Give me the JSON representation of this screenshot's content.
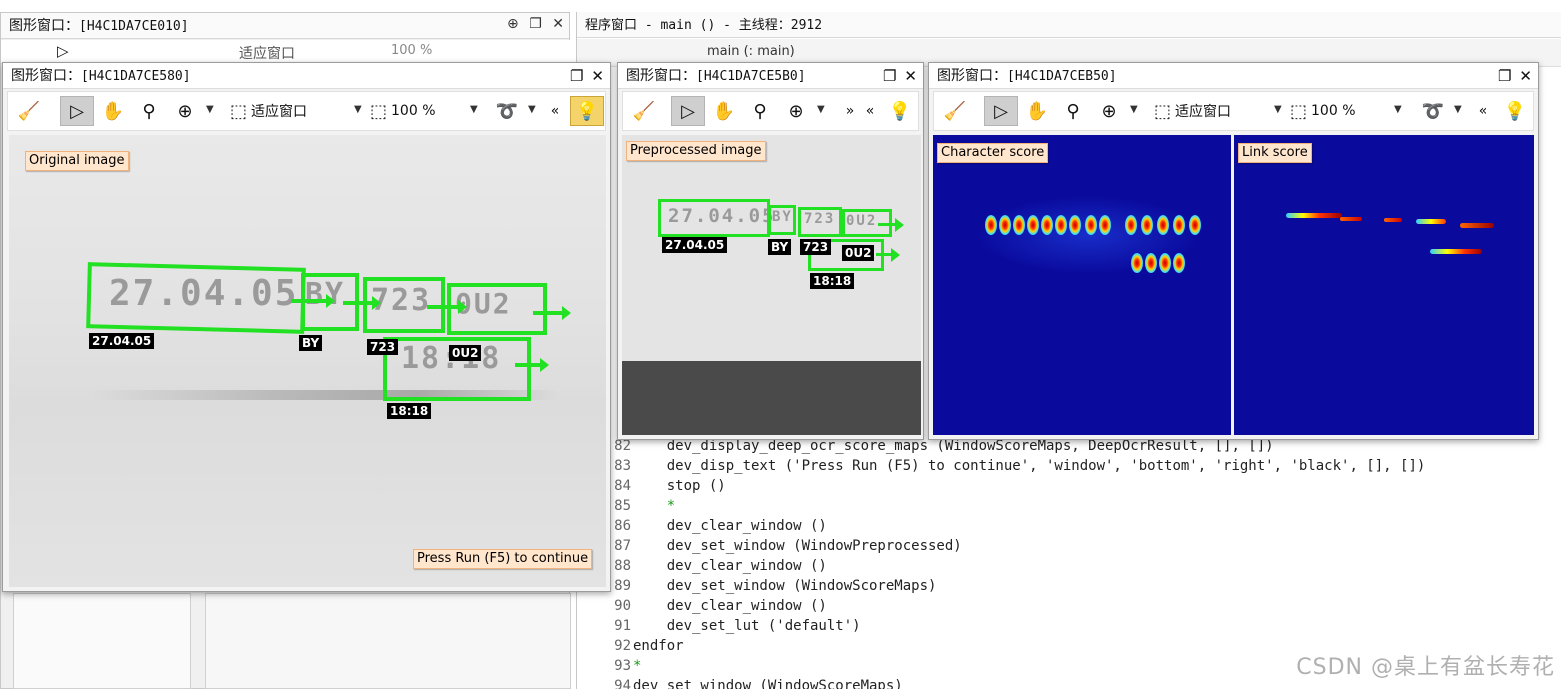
{
  "background_window": {
    "title_prefix": "图形窗口：",
    "title_id": "[H4C1DA7CE010]",
    "fit_label": "适应窗口",
    "zoom_value": "100 %"
  },
  "program_window": {
    "title": "程序窗口 - main () - 主线程：2912",
    "tab_label": "main (: main)"
  },
  "code_lines": [
    {
      "n": "82",
      "text": "    dev_display_deep_ocr_score_maps (WindowScoreMaps, DeepOcrResult, [], [])"
    },
    {
      "n": "83",
      "text": "    dev_disp_text ('Press Run (F5) to continue', 'window', 'bottom', 'right', 'black', [], [])"
    },
    {
      "n": "84",
      "text": "    stop ()"
    },
    {
      "n": "85",
      "text": "    *"
    },
    {
      "n": "86",
      "text": "    dev_clear_window ()"
    },
    {
      "n": "87",
      "text": "    dev_set_window (WindowPreprocessed)"
    },
    {
      "n": "88",
      "text": "    dev_clear_window ()"
    },
    {
      "n": "89",
      "text": "    dev_set_window (WindowScoreMaps)"
    },
    {
      "n": "90",
      "text": "    dev_clear_window ()"
    },
    {
      "n": "91",
      "text": "    dev_set_lut ('default')"
    },
    {
      "n": "92",
      "text": "endfor"
    },
    {
      "n": "93",
      "text": "*"
    },
    {
      "n": "94",
      "text": "dev_set_window (WindowScoreMaps)"
    }
  ],
  "window1": {
    "title_prefix": "图形窗口：",
    "title_id": "[H4C1DA7CE580]",
    "fit_label": "适应窗口",
    "zoom_value": "100 %",
    "image_label": "Original image",
    "continue_label": "Press Run (F5) to continue",
    "tags": [
      "27.04.05",
      "BY",
      "723",
      "0U2",
      "18:18"
    ],
    "stamps": [
      "27.04.05",
      "BY",
      "723",
      "0U2",
      "18:18"
    ]
  },
  "window2": {
    "title_prefix": "图形窗口：",
    "title_id": "[H4C1DA7CE5B0]",
    "image_label": "Preprocessed image",
    "tags": [
      "27.04.05",
      "BY",
      "723",
      "0U2",
      "18:18"
    ],
    "stamps": [
      "27.04.05",
      "BY",
      "723",
      "0U2"
    ]
  },
  "window3": {
    "title_prefix": "图形窗口：",
    "title_id": "[H4C1DA7CEB50]",
    "fit_label": "适应窗口",
    "zoom_value": "100 %",
    "char_label": "Character score",
    "link_label": "Link score"
  },
  "watermark": "CSDN @桌上有盆长寿花",
  "colors": {
    "accent_green": "#22e022",
    "score_bg": "#0a0a9c",
    "label_bg": "#ffe6cc"
  }
}
